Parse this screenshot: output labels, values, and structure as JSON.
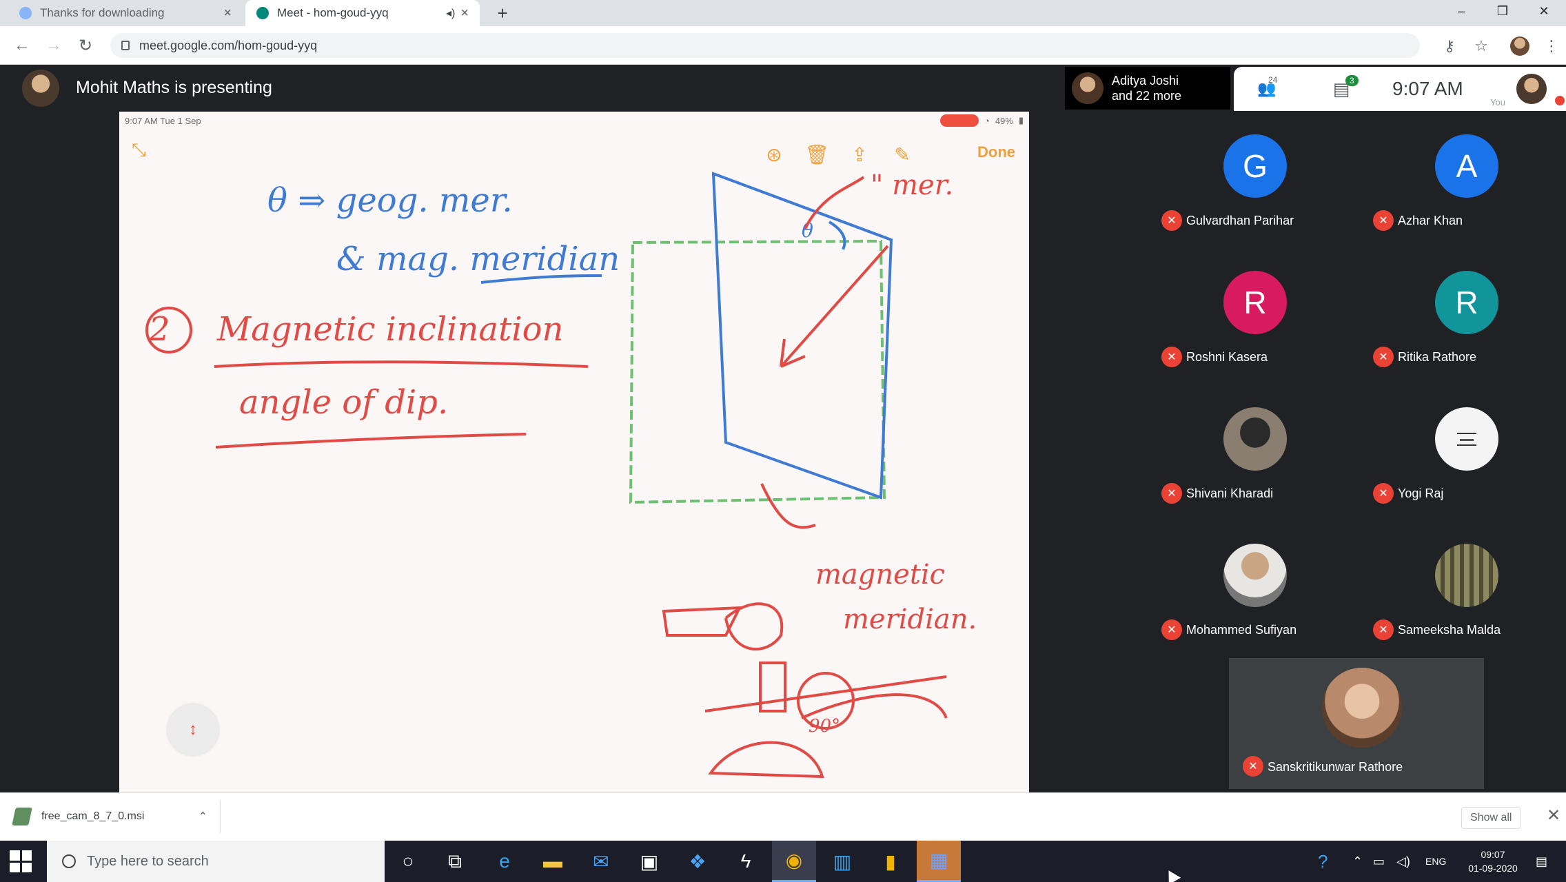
{
  "browser": {
    "tabs": [
      {
        "label": "Thanks for downloading",
        "active": false
      },
      {
        "label": "Meet - hom-goud-yyq",
        "active": true
      }
    ],
    "new_tab": "+",
    "url": "meet.google.com/hom-goud-yyq",
    "window_controls": {
      "minimize": "–",
      "maximize": "❐",
      "close": "✕"
    }
  },
  "meet": {
    "presenting_text": "Mohit Maths is presenting",
    "pinned_participant": {
      "line1": "Aditya Joshi",
      "line2": "and 22 more"
    },
    "people_count": "24",
    "chat_badge": "3",
    "clock": "9:07 AM",
    "you_label": "You"
  },
  "board": {
    "status_left": "9:07 AM   Tue 1 Sep",
    "status_right": "49%",
    "done_label": "Done",
    "notes": {
      "line1": "θ ⇒ geog. mer.",
      "line2": "& mag. meridian",
      "number": "2",
      "line3": "Magnetic inclination",
      "line4": "angle of dip.",
      "label_top": "\" mer.",
      "label_bottom1": "magnetic",
      "label_bottom2": "meridian.",
      "deg": "90°"
    }
  },
  "participants": [
    {
      "name": "Gulvardhan Parihar",
      "initial": "G",
      "color": "#1a73e8"
    },
    {
      "name": "Azhar Khan",
      "initial": "A",
      "color": "#1a73e8"
    },
    {
      "name": "Roshni Kasera",
      "initial": "R",
      "color": "#d81b60"
    },
    {
      "name": "Ritika Rathore",
      "initial": "R",
      "color": "#12959a"
    },
    {
      "name": "Shivani Kharadi",
      "initial": "",
      "color": "#5a5047"
    },
    {
      "name": "Yogi Raj",
      "initial": "",
      "color": "#f4f4f4"
    },
    {
      "name": "Mohammed Sufiyan",
      "initial": "",
      "color": "#8a8580"
    },
    {
      "name": "Sameeksha Malda",
      "initial": "",
      "color": "#6d6a4c"
    },
    {
      "name": "Sanskritikunwar Rathore",
      "initial": "",
      "color": "#c29a7e"
    }
  ],
  "download": {
    "file": "free_cam_8_7_0.msi",
    "show_all": "Show all"
  },
  "taskbar": {
    "search_placeholder": "Type here to search",
    "lang": "ENG",
    "time": "09:07",
    "date": "01-09-2020"
  }
}
